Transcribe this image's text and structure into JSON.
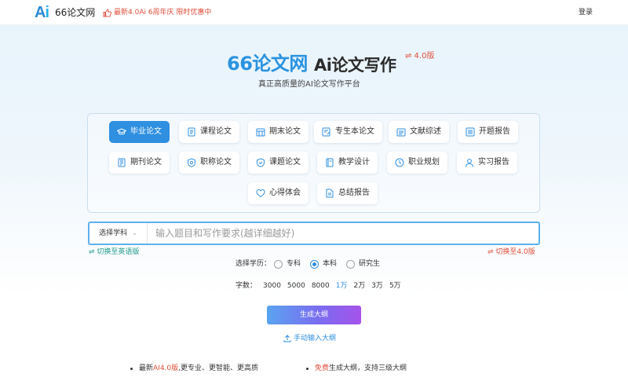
{
  "header": {
    "logo_mark": "Ai",
    "site_name": "66论文网",
    "promo_text": "最新4.0Ai 6周年庆 限时优惠中",
    "login_label": "登录"
  },
  "hero": {
    "brand": "66论文网",
    "title": "Ai论文写作",
    "version_badge": "⇌ 4.0版",
    "subtitle": "真正高质量的AI论文写作平台"
  },
  "categories": [
    {
      "label": "毕业论文",
      "icon": "graduation-cap-icon",
      "active": true
    },
    {
      "label": "课程论文",
      "icon": "document-lines-icon"
    },
    {
      "label": "期末论文",
      "icon": "calendar-grid-icon"
    },
    {
      "label": "专生本论文",
      "icon": "edit-document-icon"
    },
    {
      "label": "文献综述",
      "icon": "book-list-icon"
    },
    {
      "label": "开题报告",
      "icon": "report-icon"
    },
    {
      "label": "期刊论文",
      "icon": "journal-icon"
    },
    {
      "label": "职称论文",
      "icon": "shield-badge-icon"
    },
    {
      "label": "课题论文",
      "icon": "shield-check-icon"
    },
    {
      "label": "教学设计",
      "icon": "notebook-icon"
    },
    {
      "label": "职业规划",
      "icon": "clock-icon"
    },
    {
      "label": "实习报告",
      "icon": "person-icon"
    },
    {
      "label": "心得体会",
      "icon": "heart-icon"
    },
    {
      "label": "总结报告",
      "icon": "summary-doc-icon"
    }
  ],
  "form": {
    "subject_select": "选择学科",
    "topic_placeholder": "输入题目和写作要求(越详细越好)",
    "topic_value": "",
    "switch_english": "⇌ 切换至英语版",
    "switch_v4": "⇌ 切换至4.0版",
    "education_label": "选择学历：",
    "education_options": [
      "专科",
      "本科",
      "研究生"
    ],
    "education_selected": "本科",
    "words_label": "字数：",
    "word_options": [
      "3000",
      "5000",
      "8000",
      "1万",
      "2万",
      "3万",
      "5万"
    ],
    "word_selected": "1万",
    "generate_label": "生成大纲",
    "manual_label": "手动输入大纲"
  },
  "features": {
    "left_prefix": "最新",
    "left_highlight": "AI4.0版",
    "left_suffix": ",更专业、更智能、更高质",
    "right_highlight": "免费",
    "right_suffix": "生成大纲，支持三级大纲"
  },
  "colors": {
    "brand_blue": "#2a93e0",
    "accent_red": "#e0503c",
    "active_tab": "#2f8fe0",
    "teal_link": "#1f9a8a"
  }
}
